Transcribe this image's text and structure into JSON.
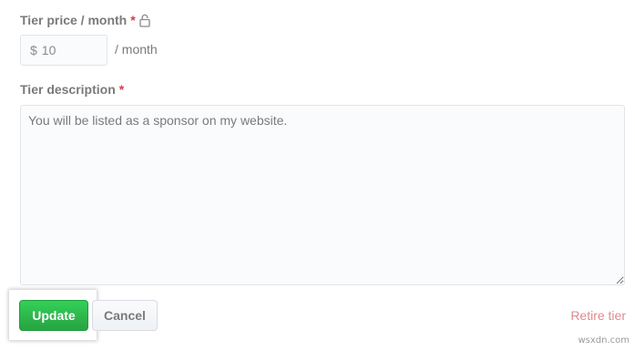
{
  "price_field": {
    "label": "Tier price / month",
    "required_mark": "*",
    "lock_icon": "lock-icon",
    "currency_symbol": "$",
    "value": "10",
    "suffix": "/ month"
  },
  "description_field": {
    "label": "Tier description",
    "required_mark": "*",
    "value": "You will be listed as a sponsor on my website."
  },
  "actions": {
    "update_label": "Update",
    "cancel_label": "Cancel",
    "retire_label": "Retire tier"
  },
  "colors": {
    "required": "#d73a49",
    "update_button": "#2ea44f",
    "retire_link": "#e08a8f"
  },
  "watermark": "wsxdn.com"
}
